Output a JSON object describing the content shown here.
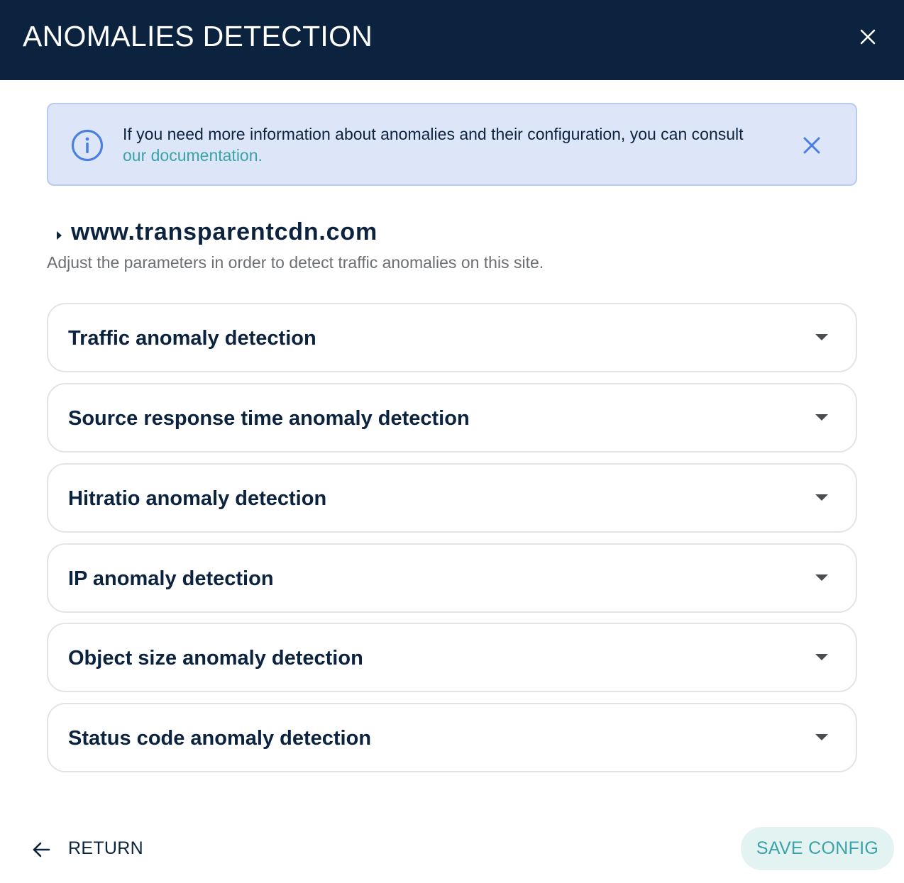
{
  "header": {
    "title": "ANOMALIES DETECTION"
  },
  "info": {
    "text": "If you need more information about anomalies and their configuration, you can consult ",
    "link": "our documentation."
  },
  "site": {
    "name": "www.transparentcdn.com",
    "description": "Adjust the parameters in order to detect traffic anomalies on this site."
  },
  "sections": [
    {
      "label": "Traffic anomaly detection"
    },
    {
      "label": "Source response time anomaly detection"
    },
    {
      "label": "Hitratio anomaly detection"
    },
    {
      "label": "IP anomaly detection"
    },
    {
      "label": "Object size anomaly detection"
    },
    {
      "label": "Status code anomaly detection"
    }
  ],
  "footer": {
    "return_label": "RETURN",
    "save_label": "SAVE CONFIG"
  },
  "colors": {
    "header_bg": "#0c2340",
    "info_bg": "#dde6f8",
    "link": "#3ba3a7",
    "save_bg": "#e3f3f1"
  }
}
